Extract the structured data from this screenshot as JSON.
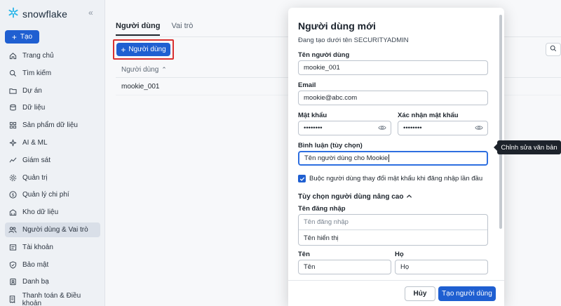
{
  "app": {
    "name": "snowflake"
  },
  "sidebar": {
    "new_label": "Tạo",
    "items": [
      {
        "label": "Trang chủ",
        "icon": "home-icon"
      },
      {
        "label": "Tìm kiếm",
        "icon": "search-icon"
      },
      {
        "label": "Dự án",
        "icon": "folder-icon"
      },
      {
        "label": "Dữ liệu",
        "icon": "database-icon"
      },
      {
        "label": "Sản phẩm dữ liệu",
        "icon": "grid-icon"
      },
      {
        "label": "AI & ML",
        "icon": "sparkle-icon"
      },
      {
        "label": "Giám sát",
        "icon": "activity-icon"
      },
      {
        "label": "Quản trị",
        "icon": "gear-icon"
      },
      {
        "label": "Quản lý chi phí",
        "icon": "dollar-icon"
      },
      {
        "label": "Kho dữ liệu",
        "icon": "warehouse-icon"
      },
      {
        "label": "Người dùng & Vai trò",
        "icon": "users-icon",
        "active": true
      },
      {
        "label": "Tài khoản",
        "icon": "account-icon"
      },
      {
        "label": "Bảo mật",
        "icon": "shield-icon"
      },
      {
        "label": "Danh bạ",
        "icon": "contacts-icon"
      },
      {
        "label": "Thanh toán & Điều khoản",
        "icon": "billing-icon"
      }
    ]
  },
  "main": {
    "tabs": [
      {
        "label": "Người dùng",
        "active": true
      },
      {
        "label": "Vai trò",
        "active": false
      }
    ],
    "add_user_label": "Người dùng",
    "table": {
      "column": "Người dùng",
      "rows": [
        "mookie_001"
      ]
    }
  },
  "modal": {
    "title": "Người dùng mới",
    "subtitle": "Đang tạo dưới tên SECURITYADMIN",
    "username_label": "Tên người dùng",
    "username_value": "mookie_001",
    "email_label": "Email",
    "email_value": "mookie@abc.com",
    "password_label": "Mật khẩu",
    "password_value": "••••••••",
    "confirm_label": "Xác nhận mật khẩu",
    "confirm_value": "••••••••",
    "comment_label": "Bình luận (tùy chọn)",
    "comment_value": "Tên người dùng cho Mookie",
    "force_change_label": "Buộc người dùng thay đổi mật khẩu khi đăng nhập lần đầu",
    "advanced_label": "Tùy chọn người dùng nâng cao",
    "login_label": "Tên đăng nhập",
    "login_placeholder": "Tên đăng nhập",
    "display_placeholder": "Tên hiển thị",
    "first_label": "Tên",
    "first_placeholder": "Tên",
    "last_label": "Họ",
    "last_placeholder": "Họ",
    "cancel_label": "Hủy",
    "create_label": "Tạo người dùng"
  },
  "tooltip": {
    "text": "Chỉnh sửa văn bản"
  },
  "colors": {
    "accent": "#1f5fd1",
    "highlight": "#d93030"
  }
}
